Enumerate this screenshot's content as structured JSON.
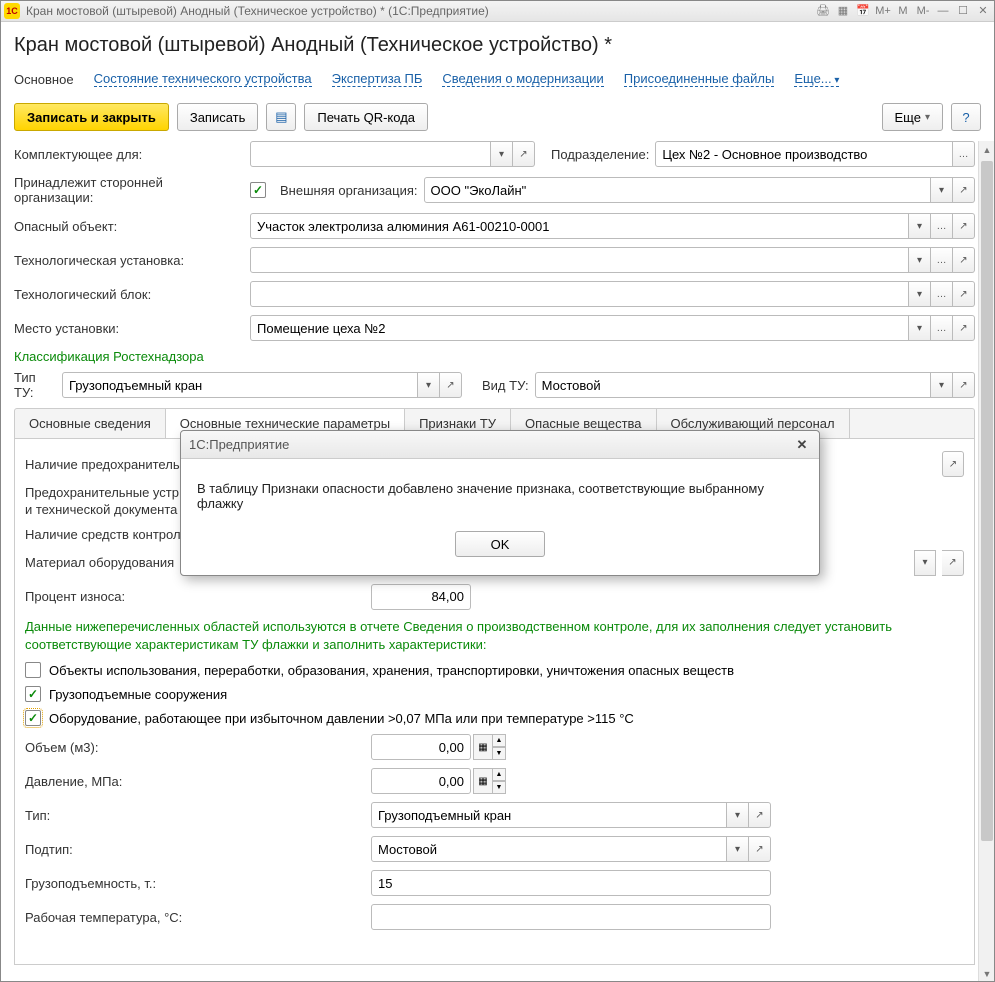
{
  "titlebar": {
    "app_badge": "1C",
    "title": "Кран мостовой (штыревой) Анодный (Техническое устройство) *  (1С:Предприятие)",
    "m1": "M+",
    "m2": "M",
    "m3": "M-"
  },
  "page_title": "Кран мостовой (штыревой) Анодный (Техническое устройство) *",
  "nav": {
    "main": "Основное",
    "status": "Состояние технического устройства",
    "expertise": "Экспертиза ПБ",
    "modern": "Сведения о модернизации",
    "attached": "Присоединенные файлы",
    "more": "Еще..."
  },
  "toolbar": {
    "save_close": "Записать и закрыть",
    "save": "Записать",
    "qr": "Печать QR-кода",
    "more": "Еще",
    "help": "?"
  },
  "fields": {
    "complect_label": "Комплектующее для:",
    "division_label": "Подразделение:",
    "division_value": "Цех №2 - Основное производство",
    "belongs_ext_label": "Принадлежит сторонней организации:",
    "ext_org_label": "Внешняя организация:",
    "ext_org_value": "ООО \"ЭкоЛайн\"",
    "danger_obj_label": "Опасный объект:",
    "danger_obj_value": "Участок электролиза алюминия А61-00210-0001",
    "tech_install_label": "Технологическая установка:",
    "tech_block_label": "Технологический блок:",
    "place_label": "Место установки:",
    "place_value": "Помещение цеха №2"
  },
  "class_header": "Классификация Ростехнадзора",
  "class": {
    "tip_tu_label": "Тип ТУ:",
    "tip_tu_value": "Грузоподъемный кран",
    "vid_tu_label": "Вид ТУ:",
    "vid_tu_value": "Мостовой"
  },
  "subtabs": {
    "t1": "Основные сведения",
    "t2": "Основные технические параметры",
    "t3": "Признаки ТУ",
    "t4": "Опасные вещества",
    "t5": "Обслуживающий персонал"
  },
  "params": {
    "safety_label": "Наличие предохранительн",
    "safety_doc_label": "Предохранительные устр\nи технической документа",
    "control_label": "Наличие средств контрол",
    "material_label": "Материал оборудования",
    "wear_label": "Процент износа:",
    "wear_value": "84,00",
    "green_note": "Данные нижеперечисленных областей используются в отчете Сведения о производственном контроле, для их заполнения следует установить соответствующие характеристикам ТУ флажки и заполнить характеристики:",
    "chk1": "Объекты использования, переработки, образования, хранения, транспортировки, уничтожения опасных веществ",
    "chk2": "Грузоподъемные сооружения",
    "chk3": "Оборудование, работающее при избыточном давлении >0,07 МПа или при температуре >115 °C",
    "vol_label": "Объем (м3):",
    "vol_value": "0,00",
    "pressure_label": "Давление, МПа:",
    "pressure_value": "0,00",
    "type_label": "Тип:",
    "type_value": "Грузоподъемный кран",
    "subtype_label": "Подтип:",
    "subtype_value": "Мостовой",
    "capacity_label": "Грузоподъемность, т.:",
    "capacity_value": "15",
    "work_temp_label": "Рабочая температура, °С:"
  },
  "dialog": {
    "title": "1С:Предприятие",
    "message": "В таблицу Признаки опасности добавлено значение признака, соответствующие выбранному флажку",
    "ok": "OK"
  }
}
